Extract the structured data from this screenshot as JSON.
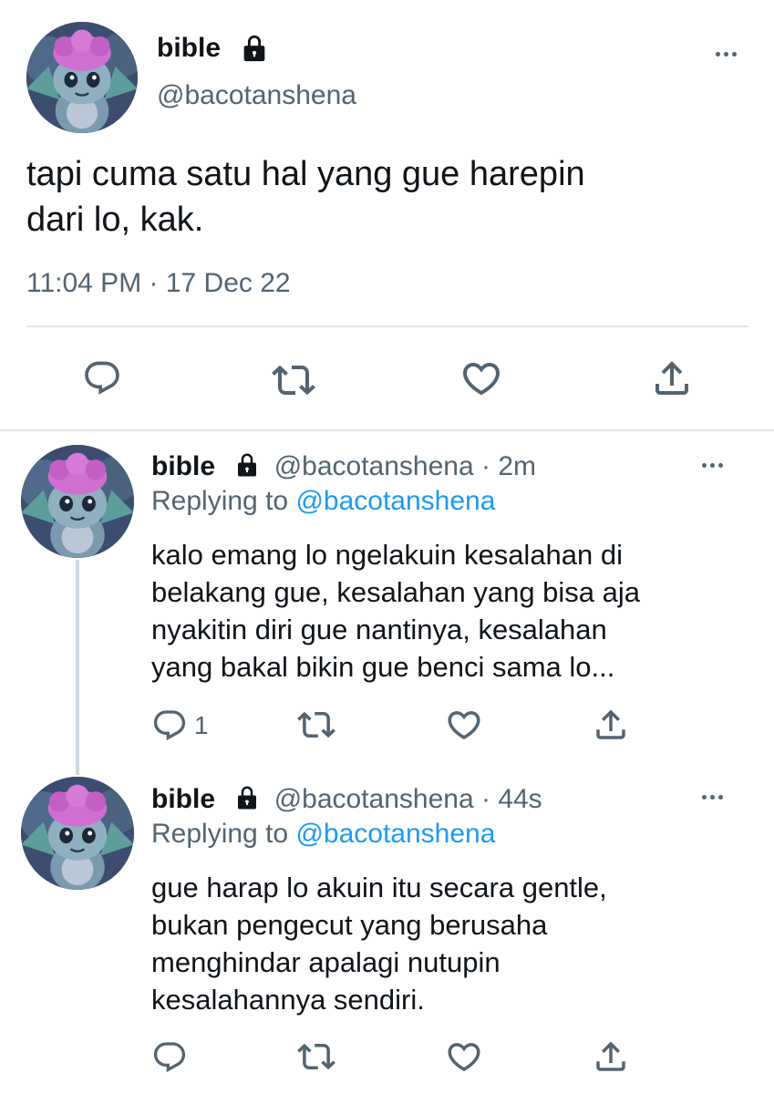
{
  "main_tweet": {
    "display_name": "bible",
    "handle": "@bacotanshena",
    "text_line1": "tapi cuma satu hal yang gue harepin",
    "text_line2": "dari lo, kak.",
    "timestamp": "11:04 PM · 17 Dec 22"
  },
  "replies": [
    {
      "display_name": "bible",
      "handle_time": "@bacotanshena · 2m",
      "replying_prefix": "Replying to ",
      "replying_to": "@bacotanshena",
      "lines": [
        "kalo emang lo ngelakuin kesalahan di",
        "belakang gue, kesalahan yang bisa aja",
        "nyakitin diri gue nantinya, kesalahan",
        "yang bakal bikin gue benci sama lo..."
      ],
      "reply_count": "1"
    },
    {
      "display_name": "bible",
      "handle_time": "@bacotanshena · 44s",
      "replying_prefix": "Replying to ",
      "replying_to": "@bacotanshena",
      "lines": [
        "gue harap lo akuin itu secara gentle,",
        "bukan pengecut yang berusaha",
        "menghindar apalagi nutupin",
        "kesalahannya sendiri."
      ],
      "reply_count": ""
    }
  ],
  "icons": [
    "lock-icon",
    "more-icon",
    "reply-icon",
    "retweet-icon",
    "like-icon",
    "share-icon"
  ],
  "colors": {
    "text": "#0f1419",
    "secondary": "#536471",
    "link": "#1d9bf0",
    "divider": "#e1e5e8"
  }
}
